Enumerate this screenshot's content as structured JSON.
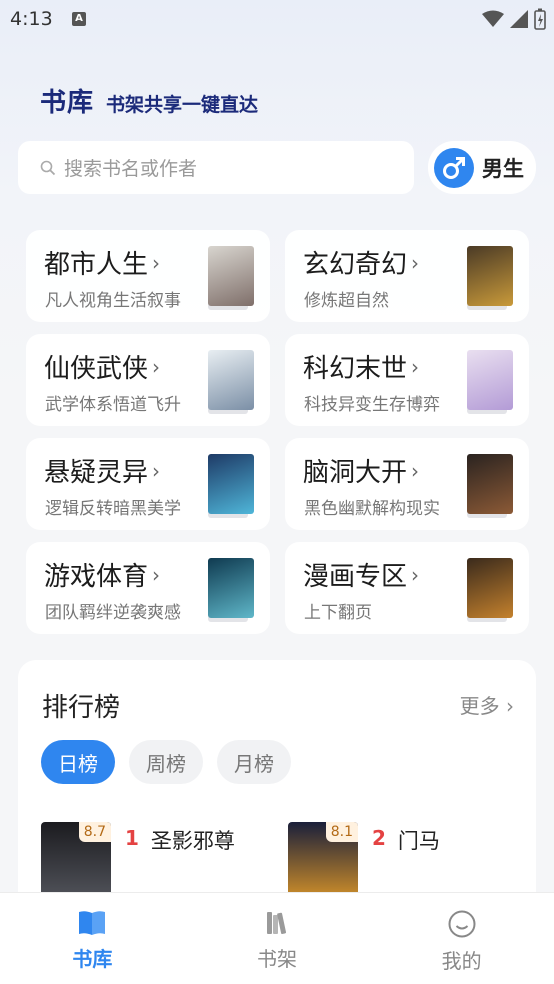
{
  "status": {
    "time": "4:13",
    "notif_letter": "A"
  },
  "header": {
    "title": "书库",
    "subtitle": "书架共享一键直达"
  },
  "search": {
    "placeholder": "搜索书名或作者"
  },
  "gender": {
    "label": "男生",
    "symbol": "♂"
  },
  "categories": [
    {
      "name": "都市人生",
      "desc": "凡人视角生活叙事",
      "cover_colors": [
        "#d8d5cf",
        "#7f6f6a"
      ]
    },
    {
      "name": "玄幻奇幻",
      "desc": "修炼超自然",
      "cover_colors": [
        "#4a3a26",
        "#c99a3a"
      ]
    },
    {
      "name": "仙侠武侠",
      "desc": "武学体系悟道飞升",
      "cover_colors": [
        "#e8eef2",
        "#7b8fa6"
      ]
    },
    {
      "name": "科幻末世",
      "desc": "科技异变生存博弈",
      "cover_colors": [
        "#e9dff0",
        "#b39bd6"
      ]
    },
    {
      "name": "悬疑灵异",
      "desc": "逻辑反转暗黑美学",
      "cover_colors": [
        "#1e3a66",
        "#4fb6d9"
      ]
    },
    {
      "name": "脑洞大开",
      "desc": "黑色幽默解构现实",
      "cover_colors": [
        "#2a2320",
        "#8c5a36"
      ]
    },
    {
      "name": "游戏体育",
      "desc": "团队羁绊逆袭爽感",
      "cover_colors": [
        "#0f3a50",
        "#5fb7c9"
      ]
    },
    {
      "name": "漫画专区",
      "desc": "上下翻页",
      "cover_colors": [
        "#3a2a1c",
        "#c4812d"
      ]
    }
  ],
  "ranking": {
    "title": "排行榜",
    "more": "更多",
    "tabs": [
      "日榜",
      "周榜",
      "月榜"
    ],
    "active_tab": "日榜",
    "items": [
      {
        "rank": "1",
        "name": "圣影邪尊",
        "score": "8.7",
        "cover_colors": [
          "#1b1b1f",
          "#4f5158"
        ]
      },
      {
        "rank": "2",
        "name": "门马",
        "score": "8.1",
        "cover_colors": [
          "#1a1f3a",
          "#c98b2a"
        ]
      }
    ]
  },
  "nav": [
    {
      "label": "书库",
      "icon": "book-icon",
      "active": true
    },
    {
      "label": "书架",
      "icon": "bookshelf-icon",
      "active": false
    },
    {
      "label": "我的",
      "icon": "smile-icon",
      "active": false
    }
  ],
  "colors": {
    "accent": "#2f86ef",
    "brand": "#1b2a7a",
    "rank_red": "#e44242"
  }
}
